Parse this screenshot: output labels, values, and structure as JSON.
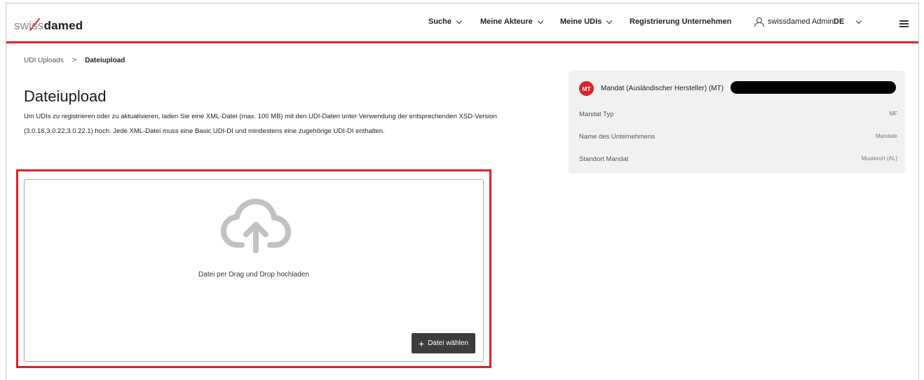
{
  "logo": {
    "swiss": "swiss",
    "damed": "damed"
  },
  "nav": {
    "items": [
      {
        "label": "Suche"
      },
      {
        "label": "Meine Akteure"
      },
      {
        "label": "Meine UDIs"
      },
      {
        "label": "Registrierung Unternehmen"
      }
    ],
    "user": "swissdamed Admin",
    "language": "DE"
  },
  "breadcrumb": {
    "parent": "UDI Uploads",
    "separator": ">",
    "current": "Dateiupload"
  },
  "page": {
    "title": "Dateiupload",
    "description_line1": "Um UDIs zu registrieren oder zu aktualisieren, laden Sie eine XML-Datei (max. 100 MB) mit den UDI-Daten unter Verwendung der entsprechenden XSD-Version",
    "description_line2": "(3.0.16,3.0.22,3.0.22.1) hoch. Jede XML-Datei muss eine Basic UDI-DI und mindestens eine zugehörige UDI-DI enthalten."
  },
  "card": {
    "badge": "MT",
    "title": "Mandat (Ausländischer Hersteller) (MT)",
    "rows": [
      {
        "label": "Mandat Typ",
        "value": "MF"
      },
      {
        "label": "Name des Unternehmens",
        "value": "Mandate"
      },
      {
        "label": "Standort Mandat",
        "value": "Musterort (AL)"
      }
    ]
  },
  "upload": {
    "drop_text": "Datei per Drag und Drop hochladen",
    "button_label": "Datei wählen"
  },
  "colors": {
    "accent": "#d8232a",
    "button": "#3c3c3c",
    "card_bg": "#f1f1f1"
  },
  "icons": [
    "user-icon",
    "chevron-down-icon",
    "menu-icon",
    "cloud-upload-icon",
    "plus-icon"
  ]
}
